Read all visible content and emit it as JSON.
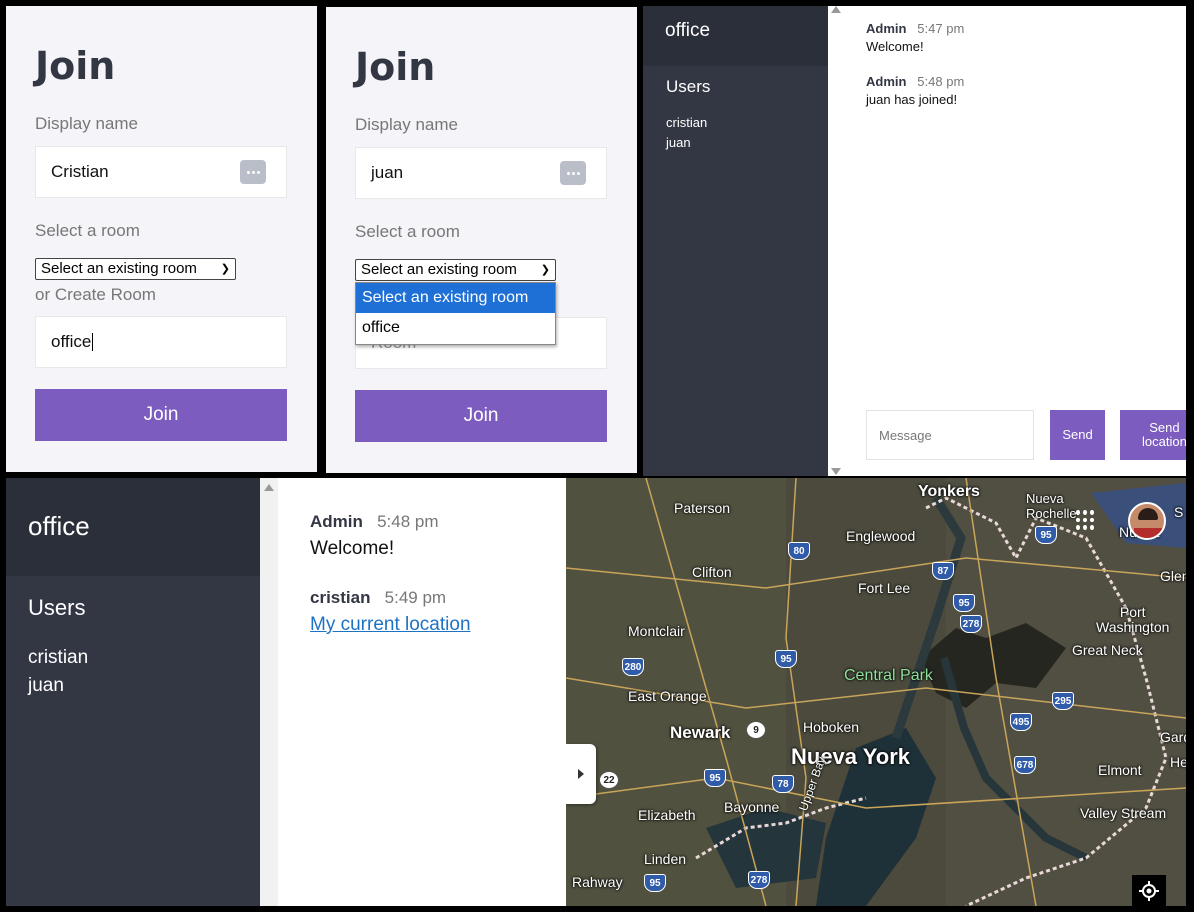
{
  "join_left": {
    "title": "Join",
    "display_name_label": "Display name",
    "display_name_value": "Cristian",
    "select_room_label": "Select a room",
    "room_select_value": "Select an existing room",
    "create_room_label": "or Create Room",
    "room_value": "office",
    "join_button": "Join"
  },
  "join_right": {
    "title": "Join",
    "display_name_label": "Display name",
    "display_name_value": "juan",
    "select_room_label": "Select a room",
    "room_select_value": "Select an existing room",
    "room_placeholder": "Room",
    "join_button": "Join",
    "dropdown_options": [
      "Select an existing room",
      "office"
    ]
  },
  "chat_top": {
    "room_name": "office",
    "users_heading": "Users",
    "users": [
      "cristian",
      "juan"
    ],
    "messages": [
      {
        "name": "Admin",
        "time": "5:47 pm",
        "text": "Welcome!"
      },
      {
        "name": "Admin",
        "time": "5:48 pm",
        "text": "juan has joined!"
      }
    ],
    "message_placeholder": "Message",
    "send_button": "Send",
    "send_location_button": "Send location"
  },
  "chat_bottom": {
    "room_name": "office",
    "users_heading": "Users",
    "users": [
      "cristian",
      "juan"
    ],
    "messages": [
      {
        "name": "Admin",
        "time": "5:48 pm",
        "text": "Welcome!"
      },
      {
        "name": "cristian",
        "time": "5:49 pm",
        "link": "My current location"
      }
    ]
  },
  "map": {
    "labels": {
      "yonkers": "Yonkers",
      "nueva_rochelle": "Nueva\nRochelle",
      "paterson": "Paterson",
      "englewood": "Englewood",
      "clifton": "Clifton",
      "fort_lee": "Fort Lee",
      "port_washington": "Port\nWashington",
      "montclair": "Montclair",
      "great_neck": "Great Neck",
      "central_park": "Central Park",
      "east_orange": "East Orange",
      "newark": "Newark",
      "hoboken": "Hoboken",
      "nueva_york": "Nueva York",
      "elmont": "Elmont",
      "elizabeth": "Elizabeth",
      "bayonne": "Bayonne",
      "upper_bay": "Upper Bay",
      "valley_stream": "Valley Stream",
      "linden": "Linden",
      "rahway": "Rahway",
      "glen": "Glen",
      "gard": "Gard",
      "he": "He",
      "nueva_partial": "Nueva",
      "s_partial": "S"
    },
    "shields": [
      "80",
      "87",
      "95",
      "278",
      "95",
      "280",
      "9",
      "495",
      "295",
      "678",
      "95",
      "78",
      "22",
      "95",
      "278",
      "95"
    ]
  }
}
